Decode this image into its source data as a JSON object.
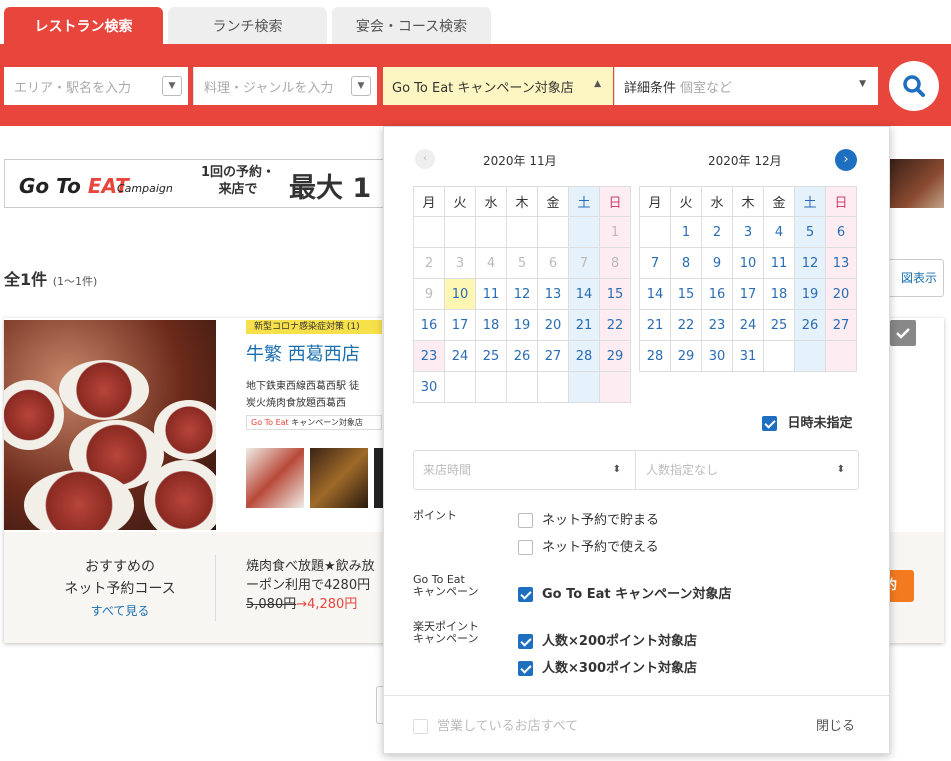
{
  "tabs": [
    {
      "label": "レストラン検索",
      "active": true
    },
    {
      "label": "ランチ検索",
      "active": false
    },
    {
      "label": "宴会・コース検索",
      "active": false
    }
  ],
  "search": {
    "area_placeholder": "エリア・駅名を入力",
    "genre_placeholder": "料理・ジャンルを入力",
    "campaign_value": "Go To Eat キャンペーン対象店",
    "detail_label": "詳細条件",
    "detail_placeholder": "個室など"
  },
  "banner": {
    "logo_main": "Go To ",
    "logo_eat": "EAT",
    "logo_sub": "Campaign",
    "text_line1": "1回の予約・",
    "text_line2": "来店で",
    "text_big": "最大 1"
  },
  "results": {
    "count": "全1件",
    "range": "(1〜1件)",
    "map_label": "図表示"
  },
  "shop": {
    "badge": "新型コロナ感染症対策 (1)",
    "name": "牛繁 西葛西店",
    "line1": "地下鉄東西線西葛西駅 徒",
    "line2": "炭火焼肉食放題西葛西",
    "gte_label": "Go To Eat",
    "gte_text": "キャンペーン対象店"
  },
  "course": {
    "title1": "おすすめの",
    "title2": "ネット予約コース",
    "see_all": "すべて見る",
    "item1": "焼肉食べ放題★飲み放",
    "item2": "ーポン利用で4280円",
    "old_price": "5,080円",
    "new_price": "→4,280円",
    "reserve": "約"
  },
  "calendar": {
    "left_month": "2020年 11月",
    "right_month": "2020年 12月",
    "weekdays": [
      "月",
      "火",
      "水",
      "木",
      "金",
      "土",
      "日"
    ],
    "no_date_label": "日時未指定",
    "no_date_checked": true
  },
  "selects": {
    "time": "来店時間",
    "people": "人数指定なし"
  },
  "points": {
    "label": "ポイント",
    "opt1": "ネット予約で貯まる",
    "opt2": "ネット予約で使える"
  },
  "goto": {
    "label1": "Go To Eat",
    "label2": "キャンペーン",
    "opt": "Go To Eat キャンペーン対象店"
  },
  "rakuten": {
    "label1": "楽天ポイント",
    "label2": "キャンペーン",
    "opt1": "人数×200ポイント対象店",
    "opt2": "人数×300ポイント対象店"
  },
  "footer": {
    "open_all": "営業しているお店すべて",
    "close": "閉じる"
  },
  "colors": {
    "brand_red": "#e8453c",
    "link_blue": "#1a6fb0",
    "check_blue": "#1f6fc0",
    "orange": "#f47a1f"
  }
}
